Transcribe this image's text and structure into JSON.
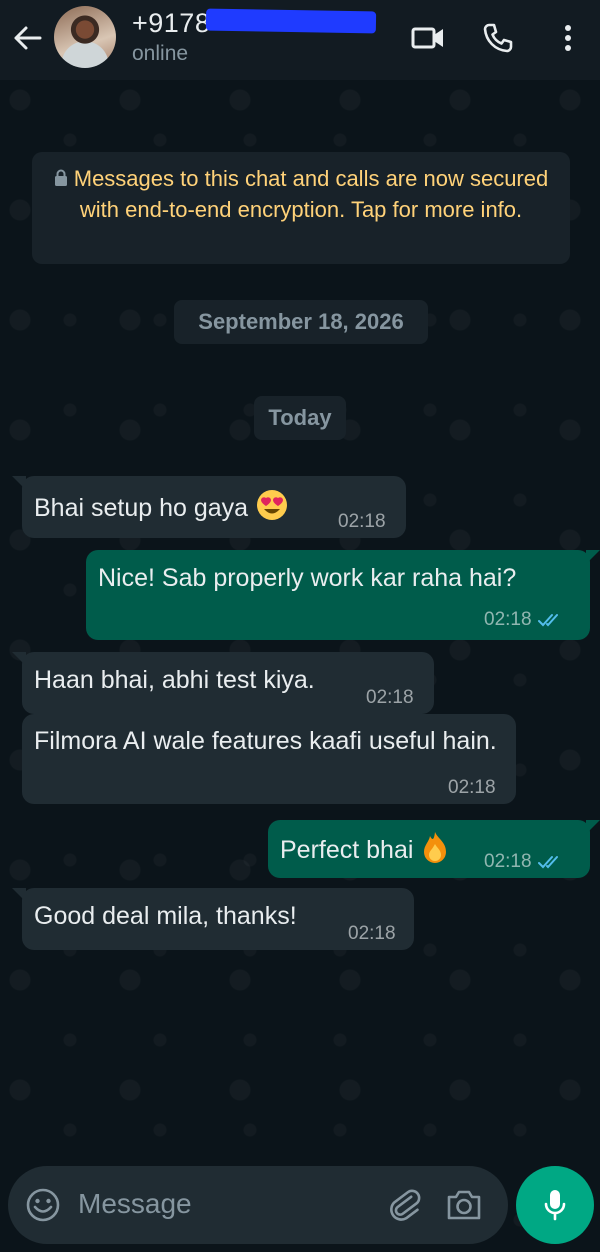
{
  "header": {
    "back_icon": "arrow-left-icon",
    "contact_name": "+9178",
    "status": "online",
    "icons": [
      "videocam-icon",
      "phone-icon",
      "more-vert-icon"
    ]
  },
  "encryption_notice": {
    "text": "Messages to this chat and calls are now secured with end-to-end encryption. Tap for more info.",
    "color": "#ffd279"
  },
  "date_pills": [
    "September 18, 2026",
    "Today"
  ],
  "messages": [
    {
      "direction": "in",
      "text": "Bhai setup ho gaya",
      "emoji": "heart-eyes",
      "time": "02:18"
    },
    {
      "direction": "out",
      "text": "Nice! Sab properly work kar raha hai?",
      "time": "02:18",
      "ticks": "read"
    },
    {
      "direction": "in",
      "text": "Haan bhai, abhi test kiya.",
      "time": "02:18"
    },
    {
      "direction": "in",
      "text": "Filmora AI wale features kaafi useful hain.",
      "time": "02:18"
    },
    {
      "direction": "out",
      "text": "Perfect bhai",
      "emoji": "fire",
      "time": "02:18",
      "ticks": "read"
    },
    {
      "direction": "in",
      "text": "Good deal mila, thanks!",
      "time": "02:18"
    }
  ],
  "input": {
    "placeholder": "Message",
    "icons": [
      "emoji-icon",
      "attach-icon",
      "camera-icon",
      "mic-icon"
    ]
  },
  "colors": {
    "background": "#0b141a",
    "incoming": "#202c33",
    "outgoing": "#005c4b",
    "accent": "#00a884",
    "read_ticks": "#53bdeb"
  }
}
